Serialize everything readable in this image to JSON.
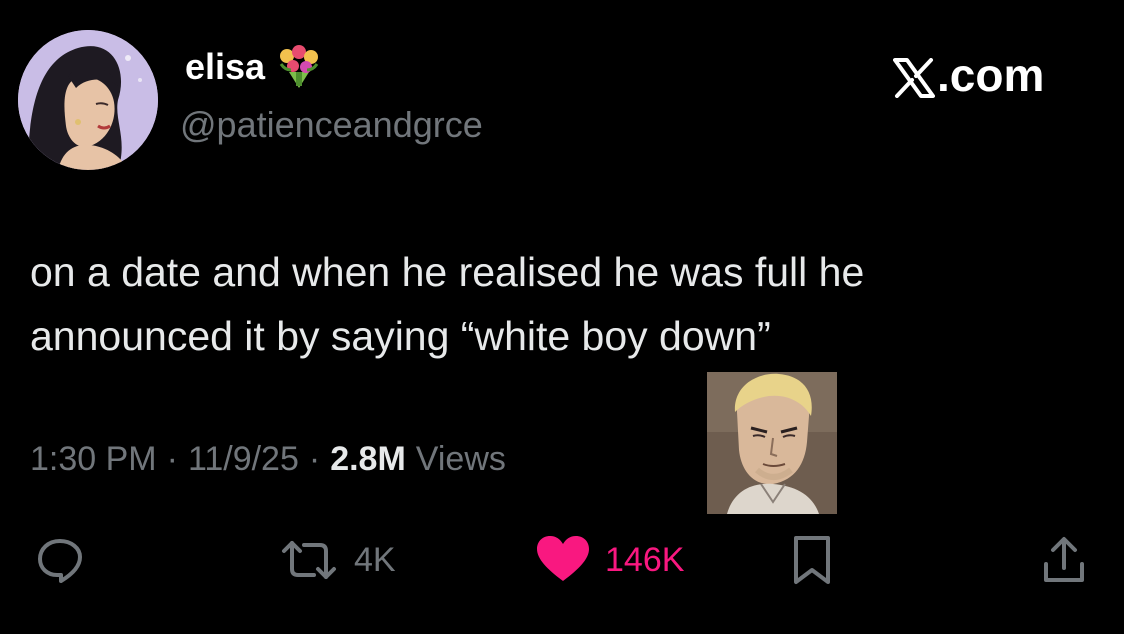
{
  "user": {
    "display_name": "elisa",
    "name_emoji": "flower-bouquet-icon",
    "handle": "@patienceandgrce",
    "avatar": "illustrated-portrait-avatar"
  },
  "brand": {
    "label": ".com",
    "logo": "x-logo-icon"
  },
  "tweet": {
    "lines": [
      "on a date and when he realised he was full he",
      "announced it by saying “white boy down”"
    ]
  },
  "meta": {
    "time": "1:30 PM",
    "separator": "·",
    "date": "11/9/25",
    "views_count": "2.8M",
    "views_label": "Views"
  },
  "attached_image": {
    "description_icon": "anime-character-portrait"
  },
  "actions": {
    "reply": {
      "icon": "reply-bubble-icon"
    },
    "repost": {
      "icon": "repost-icon",
      "count": "4K"
    },
    "like": {
      "icon": "heart-icon",
      "count": "146K",
      "liked": true
    },
    "bookmark": {
      "icon": "bookmark-icon"
    },
    "share": {
      "icon": "share-icon"
    }
  },
  "colors": {
    "background": "#000000",
    "text": "#e7e9ea",
    "secondary": "#71767b",
    "like": "#f91880"
  }
}
